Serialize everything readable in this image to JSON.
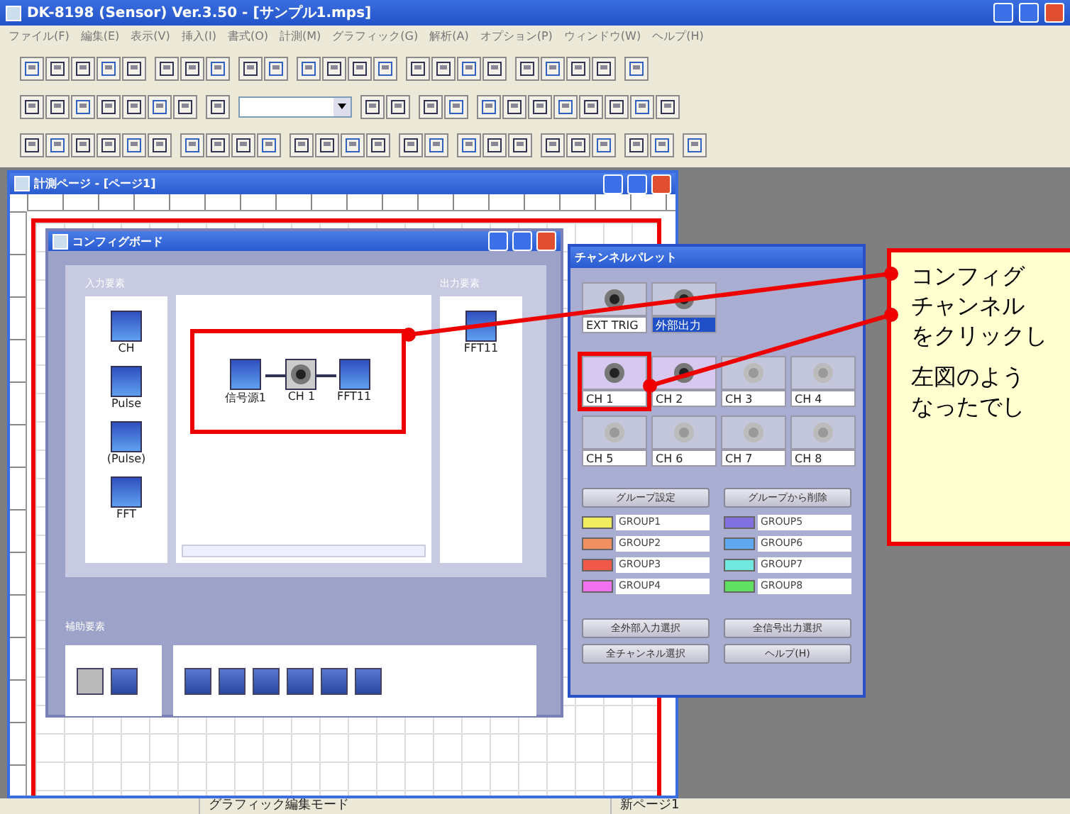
{
  "window": {
    "title": "DK-8198 (Sensor) Ver.3.50 - [サンプル1.mps]"
  },
  "menu": [
    "ファイル(F)",
    "編集(E)",
    "表示(V)",
    "挿入(I)",
    "書式(O)",
    "計測(M)",
    "グラフィック(G)",
    "解析(A)",
    "オプション(P)",
    "ウィンドウ(W)",
    "ヘルプ(H)"
  ],
  "page_window": {
    "title": "計測ページ - [ページ1]"
  },
  "config_board": {
    "title": "コンフィグボード",
    "input_label": "入力要素",
    "output_label": "出力要素",
    "bottom_label": "補助要素",
    "inputs": [
      {
        "label": "CH"
      },
      {
        "label": "Pulse"
      },
      {
        "label": "(Pulse)"
      },
      {
        "label": "FFT"
      }
    ],
    "chain": [
      {
        "label": "信号源1",
        "kind": "source"
      },
      {
        "label": "CH 1",
        "kind": "channel"
      },
      {
        "label": "FFT11",
        "kind": "fft"
      }
    ],
    "outputs": [
      {
        "label": "FFT11"
      }
    ]
  },
  "channel_palette": {
    "title": "チャンネルパレット",
    "triggers": [
      {
        "label": "EXT TRIG",
        "selected": false
      },
      {
        "label": "外部出力",
        "selected": true
      }
    ],
    "channels": [
      {
        "label": "CH 1",
        "active": true
      },
      {
        "label": "CH 2",
        "active": true
      },
      {
        "label": "CH 3",
        "active": false
      },
      {
        "label": "CH 4",
        "active": false
      },
      {
        "label": "CH 5",
        "active": false
      },
      {
        "label": "CH 6",
        "active": false
      },
      {
        "label": "CH 7",
        "active": false
      },
      {
        "label": "CH 8",
        "active": false
      }
    ],
    "group_buttons": [
      "グループ設定",
      "グループから削除"
    ],
    "groups": [
      {
        "label": "GROUP1",
        "color": "#f0ee60"
      },
      {
        "label": "GROUP5",
        "color": "#8070e0"
      },
      {
        "label": "GROUP2",
        "color": "#f09060"
      },
      {
        "label": "GROUP6",
        "color": "#60a8f0"
      },
      {
        "label": "GROUP3",
        "color": "#f05848"
      },
      {
        "label": "GROUP7",
        "color": "#70e8e0"
      },
      {
        "label": "GROUP4",
        "color": "#f070f0"
      },
      {
        "label": "GROUP8",
        "color": "#60e060"
      }
    ],
    "buttons": [
      "全外部入力選択",
      "全信号出力選択",
      "全チャンネル選択",
      "ヘルプ(H)"
    ]
  },
  "callout": {
    "lines": [
      "コンフィグ",
      "チャンネル",
      "をクリックし"
    ],
    "note": [
      "左図のよう",
      "なったでし"
    ]
  },
  "status_bar": [
    "グラフィック編集モード",
    "新ページ1"
  ]
}
